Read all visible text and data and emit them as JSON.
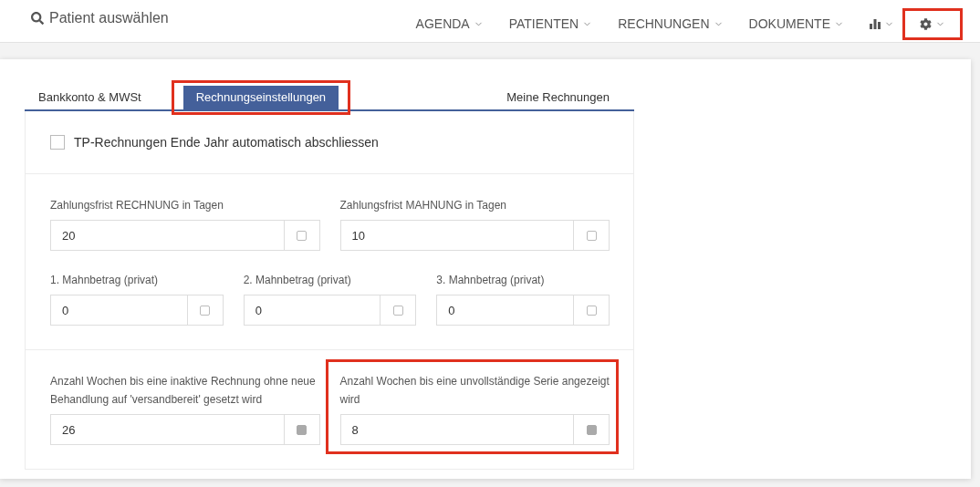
{
  "nav": {
    "search": "Patient auswählen",
    "menus": [
      {
        "kind": "text",
        "label": "AGENDA",
        "highlighted": false
      },
      {
        "kind": "text",
        "label": "PATIENTEN",
        "highlighted": false
      },
      {
        "kind": "text",
        "label": "RECHNUNGEN",
        "highlighted": false
      },
      {
        "kind": "text",
        "label": "DOKUMENTE",
        "highlighted": false
      },
      {
        "kind": "chart",
        "highlighted": false
      },
      {
        "kind": "gear",
        "highlighted": true
      }
    ]
  },
  "tabs": [
    {
      "label": "Bankkonto & MWSt",
      "selected": false,
      "highlighted": false
    },
    {
      "label": "Rechnungseinstellungen",
      "selected": true,
      "highlighted": true
    },
    {
      "label": "Meine Rechnungen",
      "selected": false,
      "highlighted": false
    }
  ],
  "checkbox": {
    "label": "TP-Rechnungen Ende Jahr automatisch abschliessen",
    "checked": false
  },
  "sections": [
    {
      "groups": [
        {
          "fields": [
            {
              "label": "Zahlungsfrist RECHNUNG in Tagen",
              "value": "20",
              "addon_filled": false,
              "highlighted": false
            },
            {
              "label": "Zahlungsfrist MAHNUNG in Tagen",
              "value": "10",
              "addon_filled": false,
              "highlighted": false
            }
          ]
        },
        {
          "fields": [
            {
              "label": "1. Mahnbetrag (privat)",
              "value": "0",
              "addon_filled": false,
              "highlighted": false
            },
            {
              "label": "2. Mahnbetrag (privat)",
              "value": "0",
              "addon_filled": false,
              "highlighted": false
            },
            {
              "label": "3. Mahnbetrag (privat)",
              "value": "0",
              "addon_filled": false,
              "highlighted": false
            }
          ]
        }
      ]
    },
    {
      "groups": [
        {
          "fields": [
            {
              "label": "Anzahl Wochen bis eine inaktive Rechnung ohne neue Behandlung auf 'versandbereit' gesetzt wird",
              "value": "26",
              "addon_filled": true,
              "highlighted": false
            },
            {
              "label": "Anzahl Wochen bis eine unvollständige Serie angezeigt wird",
              "value": "8",
              "addon_filled": true,
              "highlighted": true
            }
          ]
        }
      ]
    }
  ]
}
